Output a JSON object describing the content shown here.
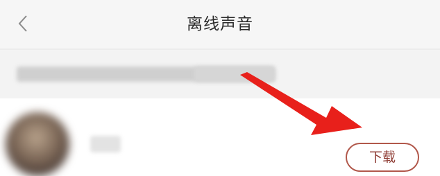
{
  "header": {
    "title": "离线声音",
    "back_icon": "chevron-left-icon"
  },
  "notice": {
    "text": ""
  },
  "list": {
    "items": [
      {
        "name": "",
        "download_label": "下载"
      }
    ]
  },
  "annotation": {
    "arrow_color": "#e8201b"
  },
  "colors": {
    "header_bg": "#f6f6f6",
    "notice_bg": "#f3f3f3",
    "button_border": "#b1584b",
    "button_text": "#8f3d35"
  }
}
